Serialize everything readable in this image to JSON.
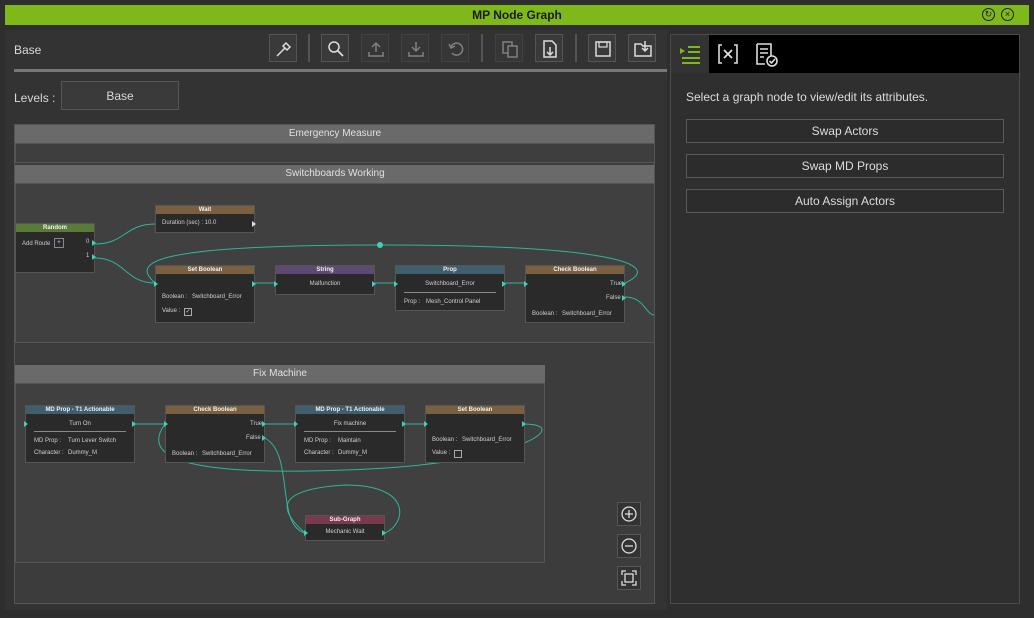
{
  "window": {
    "title": "MP Node Graph"
  },
  "breadcrumb": "Base",
  "levels": {
    "label": "Levels :",
    "value": "Base"
  },
  "toolbar": [
    "eyedropper-icon",
    "search-icon",
    "move-up-icon",
    "move-down-icon",
    "undo-icon",
    "copy-icon",
    "export-icon",
    "save-icon",
    "open-folder-icon"
  ],
  "graph": {
    "groups": {
      "emergency": "Emergency Measure",
      "switchboards": "Switchboards Working",
      "fix": "Fix Machine"
    },
    "nodes": {
      "random": {
        "title": "Random",
        "label": "Add Route",
        "out0": "0",
        "out1": "1",
        "color": "#5a7a3a"
      },
      "wait": {
        "title": "Wait",
        "duration": "Duration (sec) : 10.0",
        "color": "#7a6040"
      },
      "setbool1": {
        "title": "Set Boolean",
        "k1": "Boolean :",
        "v1": "Switchboard_Error",
        "k2": "Value :",
        "checked": "✓",
        "color": "#7a6040"
      },
      "string": {
        "title": "String",
        "value": "Malfunction",
        "color": "#5c4a72"
      },
      "prop": {
        "title": "Prop",
        "value": "Switchboard_Error",
        "k1": "Prop :",
        "v1": "Mesh_Control Panel",
        "color": "#3f5f6f"
      },
      "checkbool1": {
        "title": "Check Boolean",
        "t": "True",
        "f": "False",
        "k1": "Boolean :",
        "v1": "Switchboard_Error",
        "color": "#7a6040"
      },
      "mdprop1": {
        "title": "MD Prop - T1 Actionable",
        "value": "Turn On",
        "k1": "MD Prop :",
        "v1": "Turn Lever Switch",
        "k2": "Character :",
        "v2": "Dummy_M",
        "color": "#3f5f6f"
      },
      "checkbool2": {
        "title": "Check Boolean",
        "t": "True",
        "f": "False",
        "k1": "Boolean :",
        "v1": "Switchboard_Error",
        "color": "#7a6040"
      },
      "mdprop2": {
        "title": "MD Prop - T1 Actionable",
        "value": "Fix machine",
        "k1": "MD Prop :",
        "v1": "Maintain",
        "k2": "Character :",
        "v2": "Dummy_M",
        "color": "#3f5f6f"
      },
      "setbool2": {
        "title": "Set Boolean",
        "k1": "Boolean :",
        "v1": "Switchboard_Error",
        "k2": "Value :",
        "color": "#7a6040"
      },
      "subgraph": {
        "title": "Sub-Graph",
        "value": "Mechanic Wait",
        "color": "#7a3a4e"
      }
    },
    "zoom": [
      "zoom-in-icon",
      "zoom-out-icon",
      "fit-view-icon"
    ]
  },
  "right": {
    "tabs": [
      "attributes-tab-icon",
      "variables-tab-icon",
      "checklist-tab-icon"
    ],
    "hint": "Select a graph node to view/edit its attributes.",
    "buttons": {
      "swap_actors": "Swap Actors",
      "swap_md_props": "Swap MD Props",
      "auto_assign": "Auto Assign Actors"
    }
  },
  "colors": {
    "accent": "#7fb81a",
    "link": "#3fd1b5"
  }
}
